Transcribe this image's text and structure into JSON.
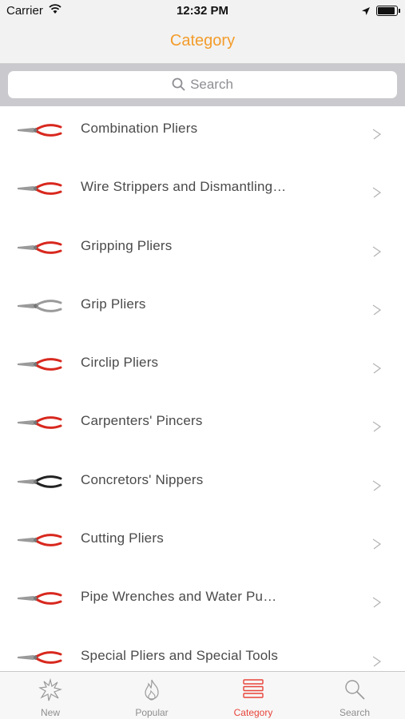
{
  "status_bar": {
    "carrier": "Carrier",
    "time": "12:32 PM",
    "battery_level": 0.95
  },
  "nav": {
    "title": "Category"
  },
  "search": {
    "placeholder": "Search"
  },
  "categories": [
    {
      "label": "Combination Pliers",
      "thumb_color": "#d8281e"
    },
    {
      "label": "Wire Strippers and Dismantling…",
      "thumb_color": "#d8281e"
    },
    {
      "label": "Gripping Pliers",
      "thumb_color": "#d8281e"
    },
    {
      "label": "Grip Pliers",
      "thumb_color": "#9a9a9a"
    },
    {
      "label": "Circlip Pliers",
      "thumb_color": "#d8281e"
    },
    {
      "label": "Carpenters' Pincers",
      "thumb_color": "#d8281e"
    },
    {
      "label": "Concretors' Nippers",
      "thumb_color": "#222222"
    },
    {
      "label": "Cutting Pliers",
      "thumb_color": "#d8281e"
    },
    {
      "label": "Pipe Wrenches and Water Pu…",
      "thumb_color": "#d8281e"
    },
    {
      "label": "Special Pliers and Special Tools",
      "thumb_color": "#d8281e"
    }
  ],
  "tabs": [
    {
      "label": "New",
      "icon": "starburst-icon",
      "active": false
    },
    {
      "label": "Popular",
      "icon": "flame-icon",
      "active": false
    },
    {
      "label": "Category",
      "icon": "list-icon",
      "active": true
    },
    {
      "label": "Search",
      "icon": "magnifier-icon",
      "active": false
    }
  ],
  "colors": {
    "accent_nav": "#f39c2b",
    "accent_tab": "#e8443a"
  }
}
